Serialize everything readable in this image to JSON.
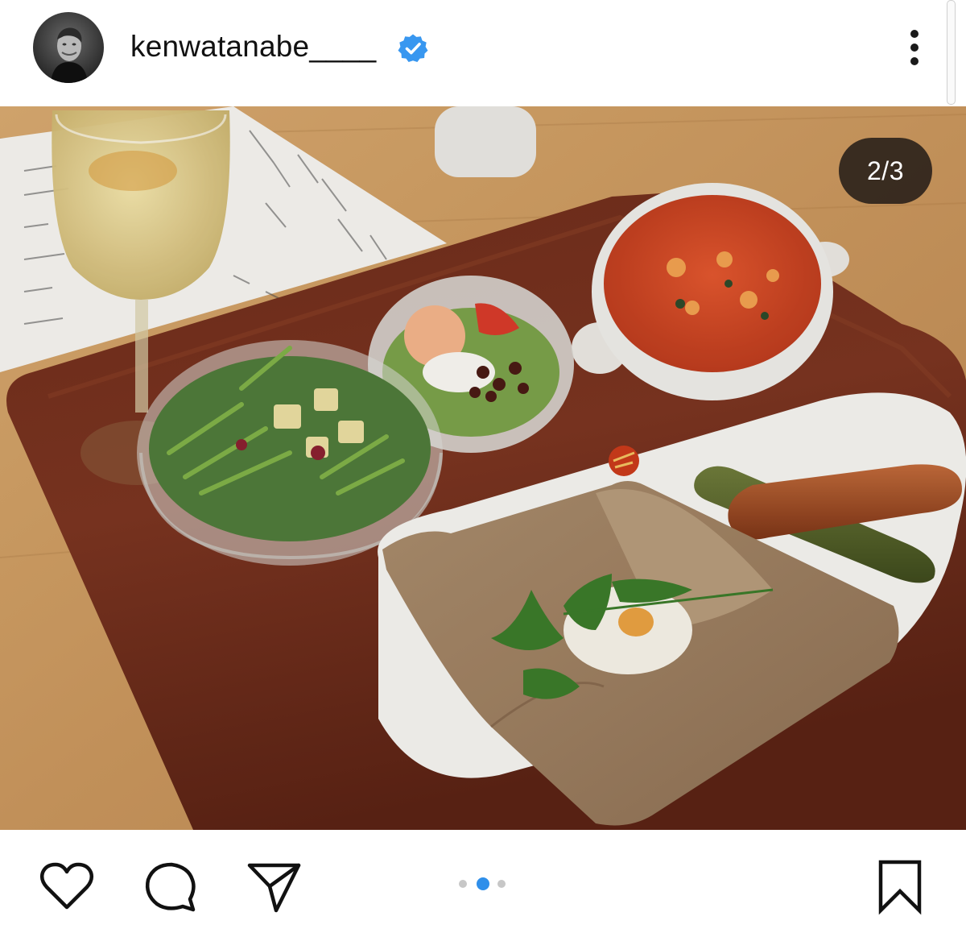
{
  "post": {
    "username": "kenwatanabe____",
    "verified": true,
    "image_counter": "2/3",
    "carousel": {
      "current": 2,
      "total": 3
    }
  },
  "icons": {
    "verified": "verified-badge-icon",
    "more": "more-options-icon",
    "like": "heart-icon",
    "comment": "comment-icon",
    "share": "paper-plane-icon",
    "save": "bookmark-icon"
  },
  "colors": {
    "verified_blue": "#3897f0",
    "active_dot": "#2f8fea",
    "inactive_dot": "#c7c7c7",
    "icon_stroke": "#111111",
    "counter_bg": "#261e18"
  }
}
